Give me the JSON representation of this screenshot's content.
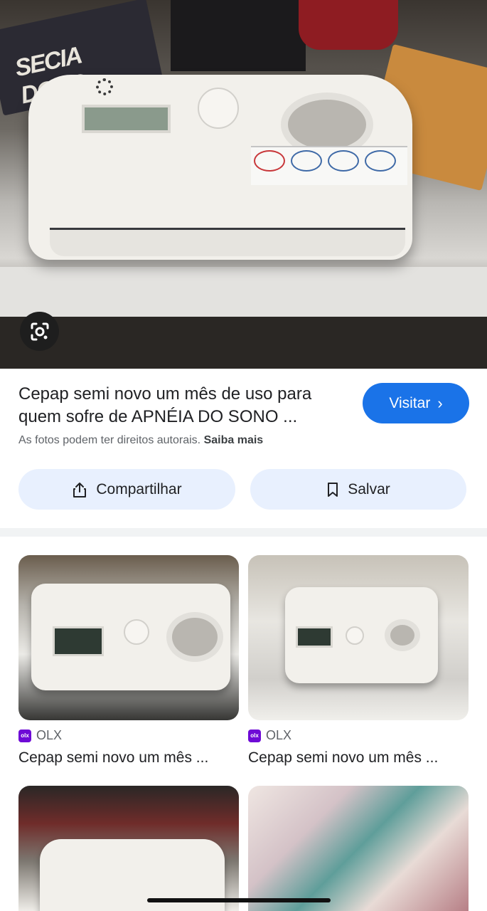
{
  "result": {
    "title": "Cepap semi novo um mês de uso para quem sofre de APNÉIA DO SONO ...",
    "visit_label": "Visitar",
    "rights_text": "As fotos podem ter direitos autorais.",
    "rights_link": "Saiba mais",
    "share_label": "Compartilhar",
    "save_label": "Salvar"
  },
  "hero": {
    "lens_icon": "google-lens-icon"
  },
  "related": [
    {
      "source": "OLX",
      "caption": "Cepap semi novo um mês ..."
    },
    {
      "source": "OLX",
      "caption": "Cepap semi novo um mês ..."
    },
    {
      "source": "",
      "caption": ""
    },
    {
      "source": "",
      "caption": ""
    }
  ],
  "colors": {
    "accent": "#1a73e8",
    "button_bg": "#e8f0fe",
    "olx_brand": "#6e0ad6"
  }
}
